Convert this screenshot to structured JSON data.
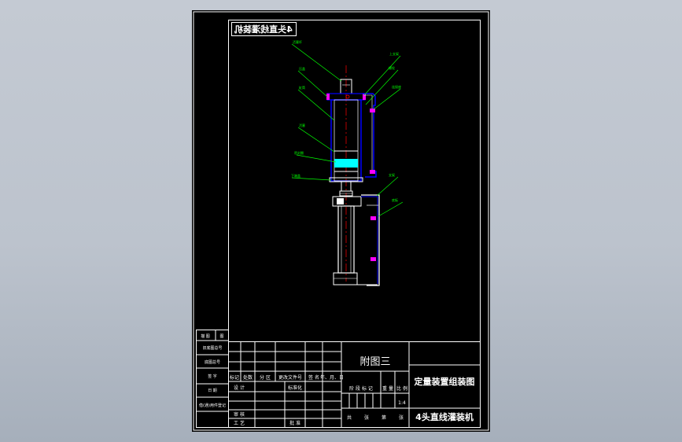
{
  "colors": {
    "viewport_background": "#c4cad3",
    "sheet": "#000000",
    "line": "#ffffff",
    "part_outline": "#0000ff",
    "leader": "#00ff00",
    "center_line": "#ff0000",
    "fluid": "#00ffff",
    "bolt": "#ff00ff"
  },
  "drawing": {
    "mirrored_stamp": "4头直线灌装机",
    "part_labels": [
      "活塞杆",
      "压盖",
      "缸筒",
      "活塞",
      "密封圈",
      "下端盖",
      "上支架",
      "螺栓",
      "连接座",
      "支架",
      "底板"
    ]
  },
  "left_column": {
    "rows": [
      {
        "label": "描 图",
        "value": "图"
      },
      {
        "label": "旧底图总号",
        "value": ""
      },
      {
        "label": "底图总号",
        "value": ""
      },
      {
        "label": "签 字",
        "value": ""
      },
      {
        "label": "日 期",
        "value": ""
      },
      {
        "label": "借(通)用件登记",
        "value": ""
      }
    ]
  },
  "title_block": {
    "drawing_name": "附图三",
    "title": "定量装置组装图",
    "machine": "4头直线灌装机",
    "revision_headers": [
      "标记",
      "处数",
      "分 区",
      "更改文件号",
      "签 名",
      "年、月、日"
    ],
    "role_labels": [
      "设 计",
      "审 核",
      "工 艺"
    ],
    "standardization": "标准化",
    "approval": "批 准",
    "stage_headers": [
      "阶 段 标 记",
      "重 量",
      "比 例"
    ],
    "scale": "1:4",
    "sheet_footer": [
      "共",
      "张",
      "第",
      "张"
    ]
  }
}
